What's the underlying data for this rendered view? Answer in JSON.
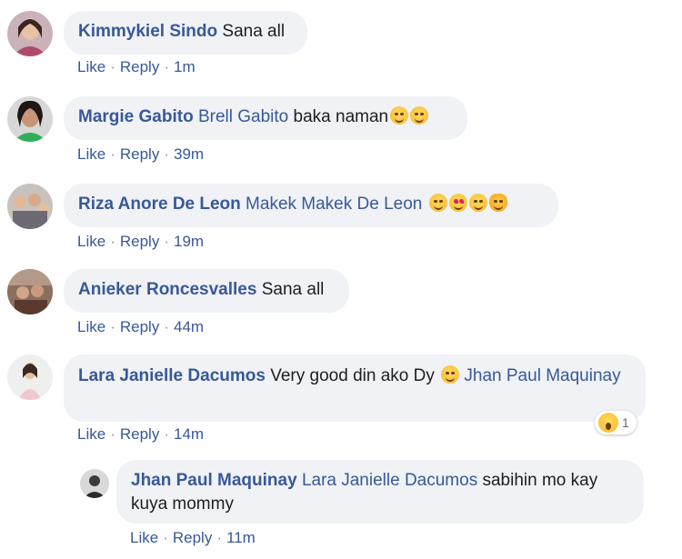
{
  "comments": [
    {
      "author": "Kimmykiel Sindo",
      "mention": "",
      "text": "Sana all",
      "emojis": [],
      "actions": {
        "like": "Like",
        "reply": "Reply",
        "time": "1m"
      }
    },
    {
      "author": "Margie Gabito",
      "mention": "Brell Gabito",
      "text": "baka naman",
      "emojis": [
        "grin-emoji",
        "grin-emoji"
      ],
      "actions": {
        "like": "Like",
        "reply": "Reply",
        "time": "39m"
      }
    },
    {
      "author": "Riza Anore De Leon",
      "mention": "Makek Makek De Leon",
      "text": "",
      "emojis": [
        "smile-emoji",
        "heart-eyes-emoji",
        "kiss-emoji",
        "cat-emoji"
      ],
      "actions": {
        "like": "Like",
        "reply": "Reply",
        "time": "19m"
      }
    },
    {
      "author": "Anieker Roncesvalles",
      "mention": "",
      "text": "Sana all",
      "emojis": [],
      "actions": {
        "like": "Like",
        "reply": "Reply",
        "time": "44m"
      }
    },
    {
      "author": "Lara Janielle Dacumos",
      "mention": "Jhan Paul Maquinay",
      "text": "Very good din ako Dy",
      "emojis": [
        "smile-emoji"
      ],
      "reaction_count": "1",
      "actions": {
        "like": "Like",
        "reply": "Reply",
        "time": "14m"
      }
    },
    {
      "author": "Jhan Paul Maquinay",
      "mention": "Lara Janielle Dacumos",
      "text": "sabihin mo kay kuya mommy",
      "emojis": [],
      "actions": {
        "like": "Like",
        "reply": "Reply",
        "time": "11m"
      }
    }
  ],
  "colors": {
    "bubble": "#f0f2f5",
    "link": "#385898",
    "text": "#1c1e21",
    "emoji": "#f5b731"
  }
}
